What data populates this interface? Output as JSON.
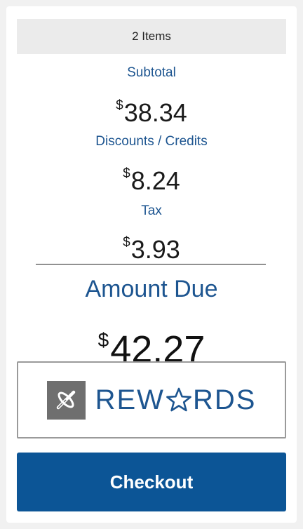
{
  "summary": {
    "items_count_label": "2 Items",
    "subtotal": {
      "label": "Subtotal",
      "currency": "$",
      "value": "38.34"
    },
    "discounts": {
      "label": "Discounts / Credits",
      "currency": "$",
      "value": "8.24"
    },
    "tax": {
      "label": "Tax",
      "currency": "$",
      "value": "3.93"
    },
    "amount_due": {
      "label": "Amount Due",
      "currency": "$",
      "value": "42.27"
    }
  },
  "rewards": {
    "text_before_star": "REW",
    "text_after_star": "RDS",
    "logo_icon": "rewards-logo-icon",
    "star_icon": "star-icon"
  },
  "checkout": {
    "label": "Checkout"
  },
  "colors": {
    "accent_blue": "#1d5590",
    "button_blue": "#0c5596",
    "logo_gray": "#6f6f6f",
    "items_bar_bg": "#ebebeb"
  }
}
